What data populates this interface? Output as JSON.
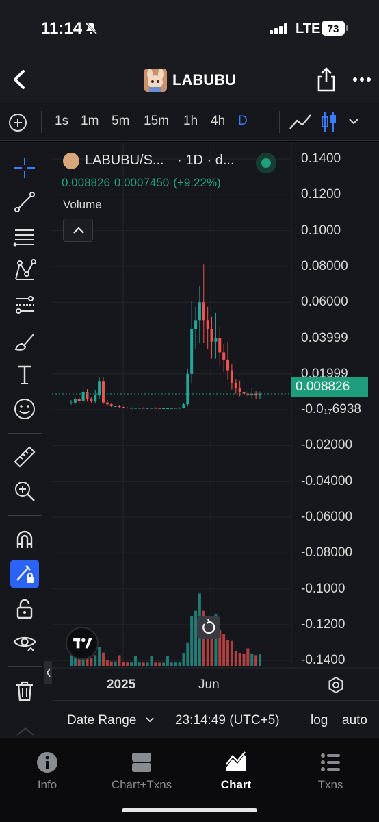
{
  "status_bar": {
    "time": "11:14",
    "network": "LTE",
    "battery": "73"
  },
  "header": {
    "title": "LABUBU"
  },
  "timeframes": [
    {
      "label": "1s",
      "active": false
    },
    {
      "label": "1m",
      "active": false
    },
    {
      "label": "5m",
      "active": false
    },
    {
      "label": "15m",
      "active": false
    },
    {
      "label": "1h",
      "active": false
    },
    {
      "label": "4h",
      "active": false
    },
    {
      "label": "D",
      "active": true
    }
  ],
  "tools": [
    "crosshair-icon",
    "trend-line-icon",
    "fib-retracement-icon",
    "pattern-icon",
    "projection-icon",
    "brush-icon",
    "text-icon",
    "emoji-icon",
    "ruler-icon",
    "zoom-in-icon",
    "magnet-icon",
    "lock-drawing-icon",
    "unlock-icon",
    "eye-icon",
    "trash-icon"
  ],
  "chart_data": {
    "type": "candlestick",
    "symbol": "LABUBU/S...",
    "interval_text": "· 1D · d...",
    "last_price": "0.008826",
    "change_abs": "0.0007450",
    "change_pct": "(+9.22%)",
    "volume_label": "Volume",
    "y_tick_labels": [
      "0.1400",
      "0.1200",
      "0.1000",
      "0.08000",
      "0.06000",
      "0.03999",
      "0.01999",
      "-0.0₁₇6938",
      "-0.02000",
      "-0.04000",
      "-0.06000",
      "-0.08000",
      "-0.1000",
      "-0.1200",
      "-0.1400"
    ],
    "ylim": [
      -0.14,
      0.14
    ],
    "x_tick_labels": [
      {
        "label": "2025",
        "bold": true
      },
      {
        "label": "Jun",
        "bold": false
      }
    ],
    "approx_close_series": [
      0.004,
      0.006,
      0.005,
      0.01,
      0.006,
      0.005,
      0.008,
      0.016,
      0.004,
      0.003,
      0.002,
      0.002,
      0.0015,
      0.0012,
      0.001,
      0.001,
      0.001,
      0.001,
      0.0009,
      0.0009,
      0.001,
      0.0009,
      0.0008,
      0.0008,
      0.0008,
      0.0009,
      0.001,
      0.001,
      0.003,
      0.02,
      0.045,
      0.05,
      0.06,
      0.05,
      0.045,
      0.038,
      0.04,
      0.032,
      0.028,
      0.022,
      0.015,
      0.012,
      0.01,
      0.009,
      0.008,
      0.009,
      0.008,
      0.0088
    ],
    "colors": {
      "up": "#26a69a",
      "down": "#ef5350",
      "background": "#16171c"
    }
  },
  "footer": {
    "date_range": "Date Range",
    "timestamp": "23:14:49 (UTC+5)",
    "log": "log",
    "auto": "auto"
  },
  "tabbar": [
    {
      "label": "Info",
      "icon": "info-icon",
      "active": false
    },
    {
      "label": "Chart+Txns",
      "icon": "split-view-icon",
      "active": false
    },
    {
      "label": "Chart",
      "icon": "chart-icon",
      "active": true
    },
    {
      "label": "Txns",
      "icon": "list-icon",
      "active": false
    }
  ],
  "colors": {
    "accent": "#3a7bff",
    "price_tag": "#1e9e7c"
  }
}
